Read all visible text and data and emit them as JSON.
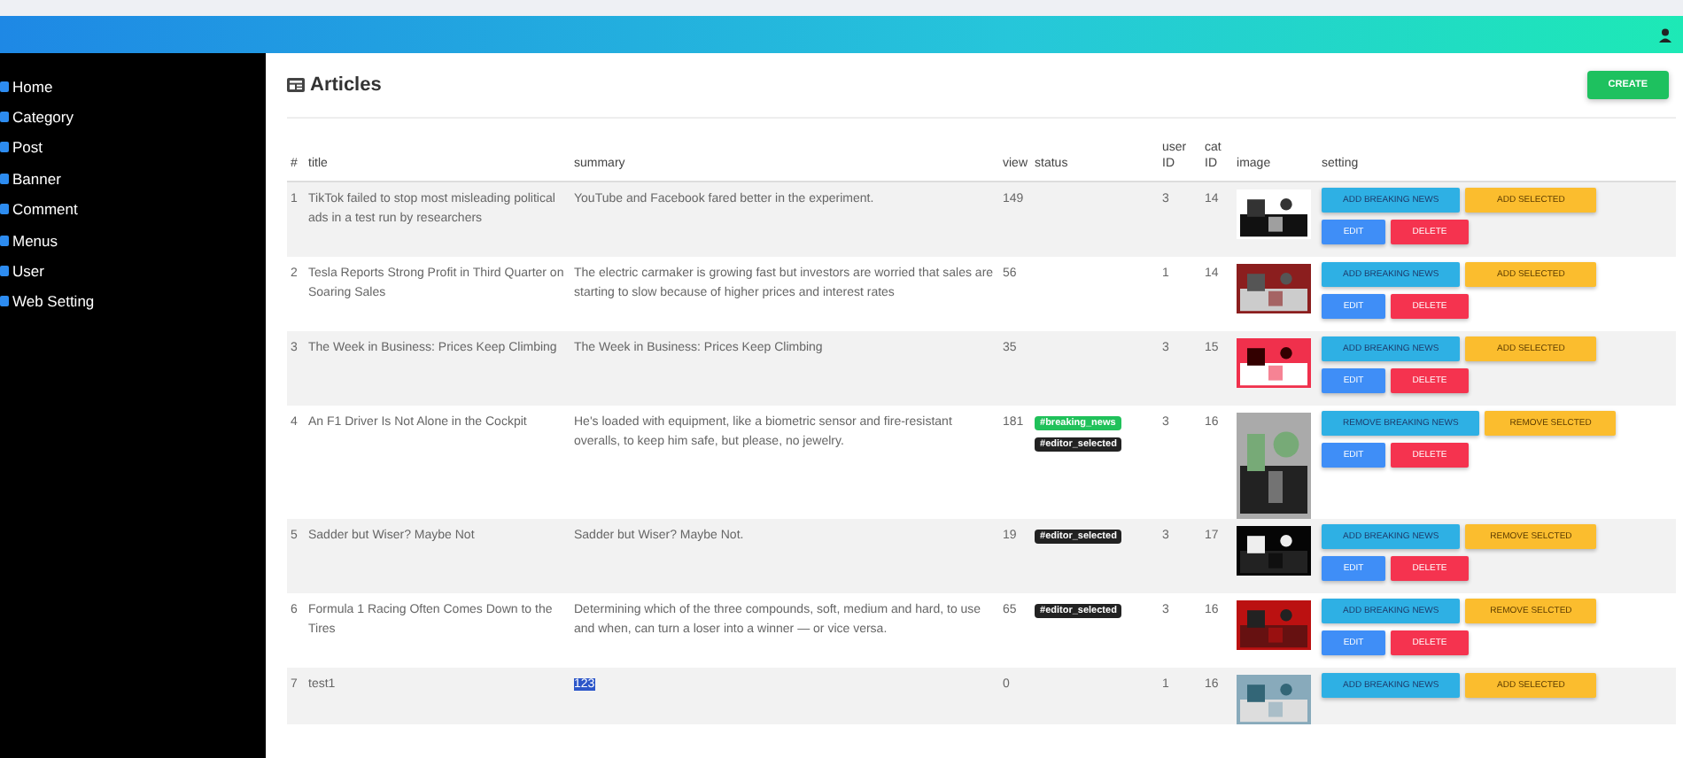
{
  "sidebar": {
    "items": [
      {
        "label": "Home"
      },
      {
        "label": "Category"
      },
      {
        "label": "Post"
      },
      {
        "label": "Banner"
      },
      {
        "label": "Comment"
      },
      {
        "label": "Menus"
      },
      {
        "label": "User"
      },
      {
        "label": "Web Setting"
      }
    ]
  },
  "page": {
    "title": "Articles",
    "create_button": "CREATE"
  },
  "table": {
    "columns": [
      "#",
      "title",
      "summary",
      "view",
      "status",
      "user ID",
      "cat ID",
      "image",
      "setting"
    ],
    "rows": [
      {
        "no": "1",
        "title": "TikTok failed to stop most misleading political ads in a test run by researchers",
        "summary": "YouTube and Facebook fared better in the experiment.",
        "summary_highlighted": false,
        "view": "149",
        "tags": [],
        "user_id": "3",
        "cat_id": "14",
        "buttons": [
          {
            "kind": "breaking",
            "label": "ADD BREAKING NEWS"
          },
          {
            "kind": "selected",
            "label": "ADD SELECTED"
          },
          {
            "kind": "edit",
            "label": "EDIT"
          },
          {
            "kind": "delete",
            "label": "DELETE"
          }
        ]
      },
      {
        "no": "2",
        "title": "Tesla Reports Strong Profit in Third Quarter on Soaring Sales",
        "summary": "The electric carmaker is growing fast but investors are worried that sales are starting to slow because of higher prices and interest rates",
        "summary_highlighted": false,
        "view": "56",
        "tags": [],
        "user_id": "1",
        "cat_id": "14",
        "buttons": [
          {
            "kind": "breaking",
            "label": "ADD BREAKING NEWS"
          },
          {
            "kind": "selected",
            "label": "ADD SELECTED"
          },
          {
            "kind": "edit",
            "label": "EDIT"
          },
          {
            "kind": "delete",
            "label": "DELETE"
          }
        ]
      },
      {
        "no": "3",
        "title": "The Week in Business: Prices Keep Climbing",
        "summary": "The Week in Business: Prices Keep Climbing",
        "summary_highlighted": false,
        "view": "35",
        "tags": [],
        "user_id": "3",
        "cat_id": "15",
        "buttons": [
          {
            "kind": "breaking",
            "label": "ADD BREAKING NEWS"
          },
          {
            "kind": "selected",
            "label": "ADD SELECTED"
          },
          {
            "kind": "edit",
            "label": "EDIT"
          },
          {
            "kind": "delete",
            "label": "DELETE"
          }
        ]
      },
      {
        "no": "4",
        "title": "An F1 Driver Is Not Alone in the Cockpit",
        "summary": "He's loaded with equipment, like a biometric sensor and fire-resistant overalls, to keep him safe, but please, no jewelry.",
        "summary_highlighted": false,
        "view": "181",
        "tags": [
          {
            "kind": "breaking",
            "label": "#breaking_news"
          },
          {
            "kind": "editor",
            "label": "#editor_selected"
          }
        ],
        "user_id": "3",
        "cat_id": "16",
        "buttons": [
          {
            "kind": "breaking",
            "label": "REMOVE BREAKING NEWS"
          },
          {
            "kind": "selected",
            "label": "REMOVE SELCTED"
          },
          {
            "kind": "edit",
            "label": "EDIT"
          },
          {
            "kind": "delete",
            "label": "DELETE"
          }
        ]
      },
      {
        "no": "5",
        "title": "Sadder but Wiser? Maybe Not",
        "summary": "Sadder but Wiser? Maybe Not.",
        "summary_highlighted": false,
        "view": "19",
        "tags": [
          {
            "kind": "editor",
            "label": "#editor_selected"
          }
        ],
        "user_id": "3",
        "cat_id": "17",
        "buttons": [
          {
            "kind": "breaking",
            "label": "ADD BREAKING NEWS"
          },
          {
            "kind": "selected",
            "label": "REMOVE SELCTED"
          },
          {
            "kind": "edit",
            "label": "EDIT"
          },
          {
            "kind": "delete",
            "label": "DELETE"
          }
        ]
      },
      {
        "no": "6",
        "title": "Formula 1 Racing Often Comes Down to the Tires",
        "summary": "Determining which of the three compounds, soft, medium and hard, to use and when, can turn a loser into a winner — or vice versa.",
        "summary_highlighted": false,
        "view": "65",
        "tags": [
          {
            "kind": "editor",
            "label": "#editor_selected"
          }
        ],
        "user_id": "3",
        "cat_id": "16",
        "buttons": [
          {
            "kind": "breaking",
            "label": "ADD BREAKING NEWS"
          },
          {
            "kind": "selected",
            "label": "REMOVE SELCTED"
          },
          {
            "kind": "edit",
            "label": "EDIT"
          },
          {
            "kind": "delete",
            "label": "DELETE"
          }
        ]
      },
      {
        "no": "7",
        "title": "test1",
        "summary": "123",
        "summary_highlighted": true,
        "view": "0",
        "tags": [],
        "user_id": "1",
        "cat_id": "16",
        "buttons": [
          {
            "kind": "breaking",
            "label": "ADD BREAKING NEWS"
          },
          {
            "kind": "selected",
            "label": "ADD SELECTED"
          }
        ]
      }
    ]
  }
}
